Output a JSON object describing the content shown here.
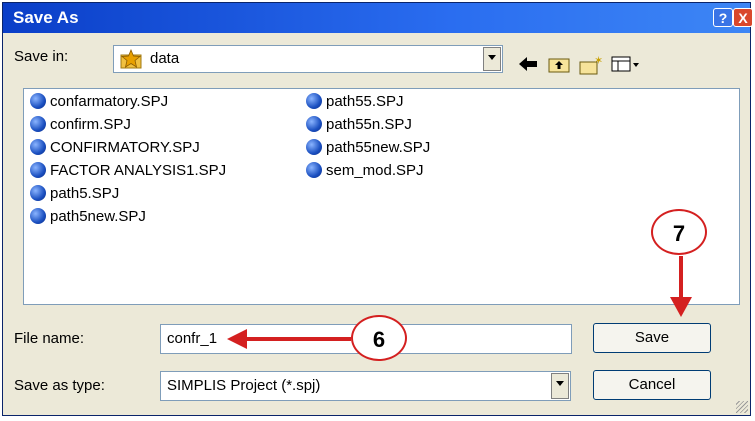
{
  "window": {
    "title": "Save As",
    "help_label": "?",
    "close_label": "X"
  },
  "save_in": {
    "label": "Save in:",
    "value": "data"
  },
  "files_col1": [
    "confarmatory.SPJ",
    "confirm.SPJ",
    "CONFIRMATORY.SPJ",
    "FACTOR ANALYSIS1.SPJ",
    "path5.SPJ",
    "path5new.SPJ"
  ],
  "files_col2": [
    "path55.SPJ",
    "path55n.SPJ",
    "path55new.SPJ",
    "sem_mod.SPJ"
  ],
  "filename": {
    "label": "File name:",
    "value": "confr_1"
  },
  "save_type": {
    "label": "Save as type:",
    "value": "SIMPLIS Project (*.spj)"
  },
  "buttons": {
    "save": "Save",
    "cancel": "Cancel"
  },
  "callouts": {
    "step6": "6",
    "step7": "7"
  },
  "icons": {
    "back": "arrow-left-icon",
    "up": "up-folder-icon",
    "new_folder": "new-folder-icon",
    "views": "view-menu-icon",
    "folder": "star-folder-icon",
    "file": "spj-file-icon"
  },
  "colors": {
    "titlebar": "#0a3ec8",
    "callout_border": "#d42020",
    "dialog_bg": "#ece9d8"
  }
}
